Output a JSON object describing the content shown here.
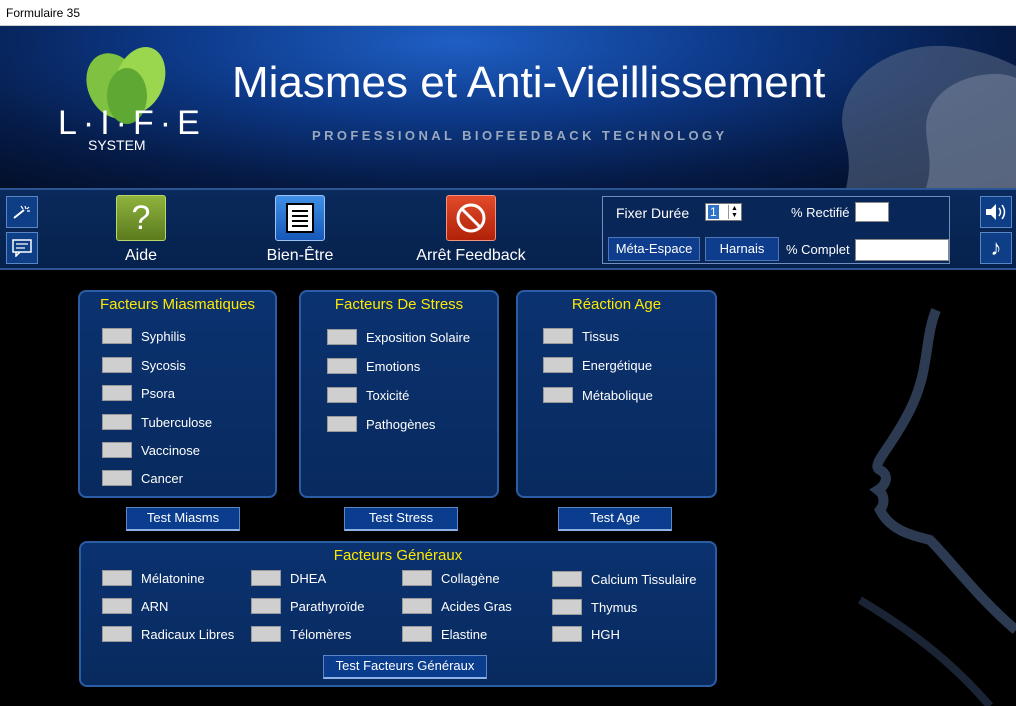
{
  "window": {
    "title": "Formulaire 35"
  },
  "header": {
    "logo_text": "L·I·F·E",
    "logo_sub": "SYSTEM",
    "title": "Miasmes et Anti-Vieillissement",
    "tagline": "PROFESSIONAL BIOFEEDBACK TECHNOLOGY"
  },
  "toolbar": {
    "aide_label": "Aide",
    "bienetre_label": "Bien-Être",
    "arret_label": "Arrêt Feedback"
  },
  "duration": {
    "fixer_label": "Fixer Durée",
    "fixer_value": "1",
    "rectifie_label": "% Rectifié",
    "complet_label": "% Complet",
    "meta_label": "Méta-Espace",
    "harnais_label": "Harnais"
  },
  "miasmes": {
    "title": "Facteurs Miasmatiques",
    "items": [
      "Syphilis",
      "Sycosis",
      "Psora",
      "Tuberculose",
      "Vaccinose",
      "Cancer"
    ],
    "test_label": "Test Miasms"
  },
  "stress": {
    "title": "Facteurs De Stress",
    "items": [
      "Exposition Solaire",
      "Emotions",
      "Toxicité",
      "Pathogènes"
    ],
    "test_label": "Test Stress"
  },
  "age": {
    "title": "Réaction Age",
    "items": [
      "Tissus",
      "Energétique",
      "Métabolique"
    ],
    "test_label": "Test Age"
  },
  "generaux": {
    "title": "Facteurs Généraux",
    "items": [
      "Mélatonine",
      "DHEA",
      "Collagène",
      "Calcium Tissulaire",
      "ARN",
      "Parathyroïde",
      "Acides Gras",
      "Thymus",
      "Radicaux Libres",
      "Télomères",
      "Elastine",
      "HGH"
    ],
    "test_label": "Test Facteurs Généraux"
  },
  "colors": {
    "panel_title": "#ffe800",
    "panel_border": "#2b5da5",
    "accent_blue": "#0b3d8e"
  }
}
